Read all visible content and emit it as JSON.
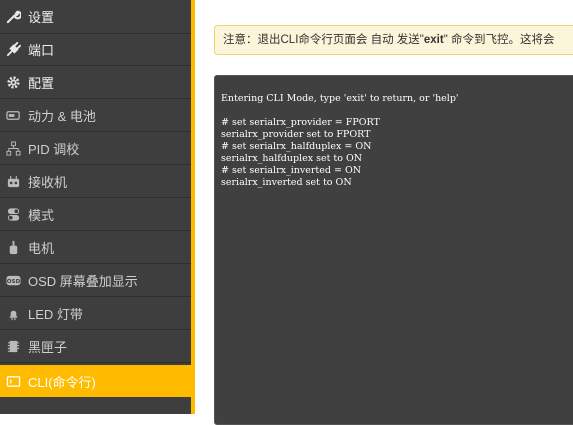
{
  "sidebar": {
    "items": [
      {
        "label": "设置",
        "icon": "wrench-icon"
      },
      {
        "label": "端口",
        "icon": "plug-icon"
      },
      {
        "label": "配置",
        "icon": "gear-icon"
      },
      {
        "label": "动力 & 电池",
        "icon": "battery-icon"
      },
      {
        "label": "PID 调校",
        "icon": "sitemap-icon"
      },
      {
        "label": "接收机",
        "icon": "receiver-icon"
      },
      {
        "label": "模式",
        "icon": "toggle-icon"
      },
      {
        "label": "电机",
        "icon": "motor-icon"
      },
      {
        "label": "OSD 屏幕叠加显示",
        "icon": "osd-icon"
      },
      {
        "label": "LED 灯带",
        "icon": "led-icon"
      },
      {
        "label": "黑匣子",
        "icon": "blackbox-icon"
      },
      {
        "label": "CLI(命令行)",
        "icon": "terminal-icon"
      }
    ],
    "active_index": 11
  },
  "notice": {
    "prefix": "注意：退出CLI命令行页面会 自动 发送\"",
    "keyword": "exit",
    "suffix": "\" 命令到飞控。这将会"
  },
  "cli": {
    "lines": [
      "Entering CLI Mode, type 'exit' to return, or 'help'",
      "",
      "# set serialrx_provider = FPORT",
      "serialrx_provider set to FPORT",
      "# set serialrx_halfduplex = ON",
      "serialrx_halfduplex set to ON",
      "# set serialrx_inverted = ON",
      "serialrx_inverted set to ON"
    ]
  },
  "colors": {
    "accent": "#ffbb00",
    "sidebar_bg": "#3e3e3e",
    "terminal_bg": "#404040",
    "notice_bg": "#fbf6d9"
  }
}
